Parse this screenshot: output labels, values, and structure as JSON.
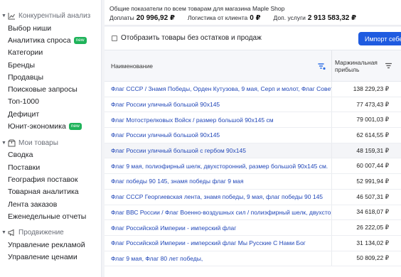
{
  "sidebar": {
    "sections": [
      {
        "title": "Конкурентный анализ",
        "icon": "chart-line-icon",
        "items": [
          {
            "label": "Выбор ниши"
          },
          {
            "label": "Аналитика спроса",
            "badge": "new"
          },
          {
            "label": "Категории"
          },
          {
            "label": "Бренды"
          },
          {
            "label": "Продавцы"
          },
          {
            "label": "Поисковые запросы"
          },
          {
            "label": "Топ-1000"
          },
          {
            "label": "Дефицит"
          },
          {
            "label": "Юнит-экономика",
            "badge": "new"
          }
        ]
      },
      {
        "title": "Мои товары",
        "icon": "box-icon",
        "items": [
          {
            "label": "Сводка"
          },
          {
            "label": "Поставки"
          },
          {
            "label": "География поставок"
          },
          {
            "label": "Товарная аналитика"
          },
          {
            "label": "Лента заказов"
          },
          {
            "label": "Еженедельные отчеты"
          }
        ]
      },
      {
        "title": "Продвижение",
        "icon": "megaphone-icon",
        "items": [
          {
            "label": "Управление рекламой"
          },
          {
            "label": "Управление ценами"
          }
        ]
      }
    ]
  },
  "summary": {
    "title": "Общие показатели по всем товарам для магазина Maple Shop",
    "metrics": [
      {
        "label": "Доплаты",
        "value": "20 996,92 ₽"
      },
      {
        "label": "Логистика от клиента",
        "value": "0 ₽"
      },
      {
        "label": "Доп. услуги",
        "value": "2 913 583,32 ₽"
      }
    ]
  },
  "toolbar": {
    "checkbox_label": "Отобразить товары без остатков и продаж",
    "import_button": "Импорт себестоимости"
  },
  "table": {
    "col_name": "Наименование",
    "col_margin_line1": "Маржинальная",
    "col_margin_line2": "прибыль",
    "rows": [
      {
        "name": "Флаг СССР / Знамя Победы, Орден Кутузова, 9 мая, Серп и молот, Флаг Советского Союза",
        "margin": "138 229,23 ₽"
      },
      {
        "name": "Флаг России уличный большой 90х145",
        "margin": "77 473,43 ₽"
      },
      {
        "name": "Флаг Мотострелковых Войск / размер большой 90х145 см",
        "margin": "79 001,03 ₽"
      },
      {
        "name": "Флаг России уличный большой 90х145",
        "margin": "62 614,55 ₽"
      },
      {
        "name": "Флаг России уличный большой с гербом 90х145",
        "margin": "48 159,31 ₽"
      },
      {
        "name": "Флаг 9 мая, полиэфирный шелк, двухсторонний, размер большой 90х145 см.",
        "margin": "60 007,44 ₽"
      },
      {
        "name": "Флаг победы 90 145, знамя победы флаг 9 мая",
        "margin": "52 991,94 ₽"
      },
      {
        "name": "Флаг СССР Георгиевская лента, знамя победы, 9 мая, флаг победы 90 145",
        "margin": "46 507,31 ₽"
      },
      {
        "name": "Флаг ВВС России / Флаг Военно-воздушных сил / полиэфирный шелк, двухсторонний",
        "margin": "34 618,07 ₽"
      },
      {
        "name": "Флаг Российской Империи - имперский флаг",
        "margin": "26 222,05 ₽"
      },
      {
        "name": "Флаг Российской Империи - имперский флаг Мы Русские С Нами Бог",
        "margin": "31 134,02 ₽"
      },
      {
        "name": "Флаг 9 мая, Флаг 80 лет победы,",
        "margin": "50 809,22 ₽"
      }
    ]
  }
}
